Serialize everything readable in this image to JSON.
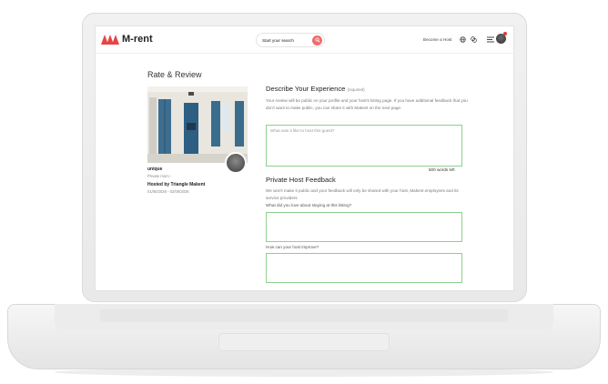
{
  "header": {
    "brand": "M-rent",
    "search_placeholder": "Start your search",
    "become_host": "Become a Host"
  },
  "colors": {
    "brand_red": "#e64545",
    "search_button": "#f26b6b",
    "field_border": "#8ed08e",
    "notification": "#e53935"
  },
  "icons": [
    "logo-mark-icon",
    "search-icon",
    "globe-icon",
    "currency-icon",
    "menu-icon"
  ],
  "page": {
    "title": "Rate & Review"
  },
  "property": {
    "name": "unique",
    "type": "Private room -",
    "hosted_by": "Hosted by Triangle Makent",
    "dates": "01/06/2026 - 02/06/2026"
  },
  "experience": {
    "title": "Describe Your Experience",
    "required": "(required)",
    "description": "Your review will be public on your profile and your host's listing page. If you have additional feedback that you don't want to make public, you can share it with Makent on the next page.",
    "placeholder": "What was it like to host this guest?",
    "words_left": "500 words left"
  },
  "private_feedback": {
    "title": "Private Host Feedback",
    "description": "We won't make it public and your feedback will only be shared with your host, Makent employees and its service providers",
    "q1_label": "What did you love about staying at this listing?",
    "q2_label": "How can your host improve?"
  }
}
